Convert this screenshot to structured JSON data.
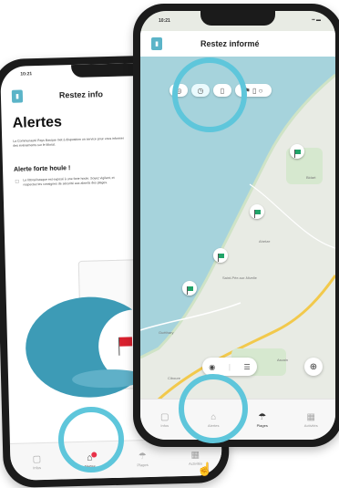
{
  "back_phone": {
    "status_time": "10:21",
    "header_title": "Restez info",
    "page_title": "Alertes",
    "intro_text": "La Communauté Pays Basque met à disposition un service pour vous informer des événements sur le littoral.",
    "alert_title": "Alerte forte houle !",
    "alert_text": "Le littoral basque est exposé à une forte houle. Soyez vigilant, et respectez les consignes de sécurité aux abords des plages.",
    "tabs": [
      {
        "label": "Infos",
        "icon": "info-icon"
      },
      {
        "label": "Alertes",
        "icon": "bell-icon"
      },
      {
        "label": "Plages",
        "icon": "umbrella-icon"
      },
      {
        "label": "Activités",
        "icon": "grid-icon"
      }
    ],
    "alert_dot_color": "#e8334a"
  },
  "front_phone": {
    "status_time": "10:21",
    "header_title": "Restez informé",
    "filter_icons": [
      "location-icon",
      "clock-icon",
      "bin-icon",
      "flag-icon"
    ],
    "map_labels": [
      "Bidart",
      "Guéthary",
      "Ahetze",
      "Saint-Pée-sur-Nivelle",
      "Ascain",
      "Ciboure"
    ],
    "tabs": [
      {
        "label": "Infos",
        "icon": "info-icon"
      },
      {
        "label": "Alertes",
        "icon": "bell-icon"
      },
      {
        "label": "Plages",
        "icon": "umbrella-icon"
      },
      {
        "label": "Activités",
        "icon": "grid-icon"
      }
    ],
    "flag_color": "#21a469",
    "sea_color": "#a6d3dc",
    "land_color": "#e8ebe4"
  },
  "highlight_color": "#5ec6db"
}
